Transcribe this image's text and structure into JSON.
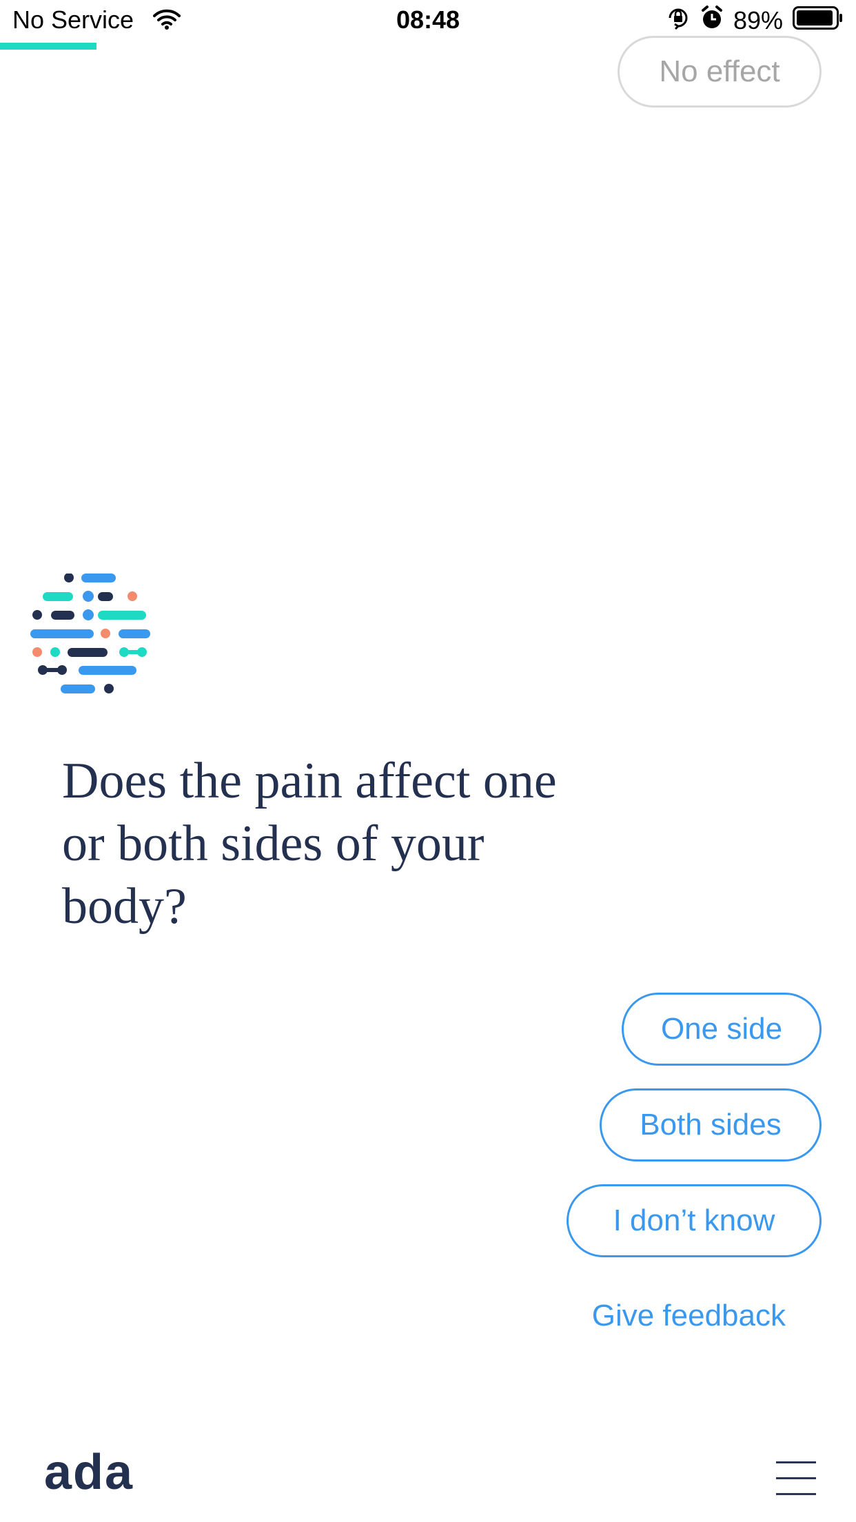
{
  "status_bar": {
    "carrier": "No Service",
    "time": "08:48",
    "battery_percent": "89%",
    "icons": [
      "wifi-icon",
      "orientation-lock-icon",
      "alarm-icon",
      "battery-icon"
    ]
  },
  "progress": {
    "fraction": 0.113
  },
  "previous_answer": {
    "label": "No effect"
  },
  "question": {
    "text": "Does the pain affect one or both sides of your body?"
  },
  "answers": [
    {
      "label": "One side"
    },
    {
      "label": "Both sides"
    },
    {
      "label": "I don’t know"
    }
  ],
  "feedback": {
    "label": "Give feedback"
  },
  "footer": {
    "brand": "ada",
    "menu_icon": "hamburger-menu-icon"
  },
  "colors": {
    "accent_blue": "#3a98ee",
    "teal": "#1ed9c3",
    "navy": "#24304f",
    "coral": "#f48b6c",
    "muted_border": "#d9d9d9"
  }
}
